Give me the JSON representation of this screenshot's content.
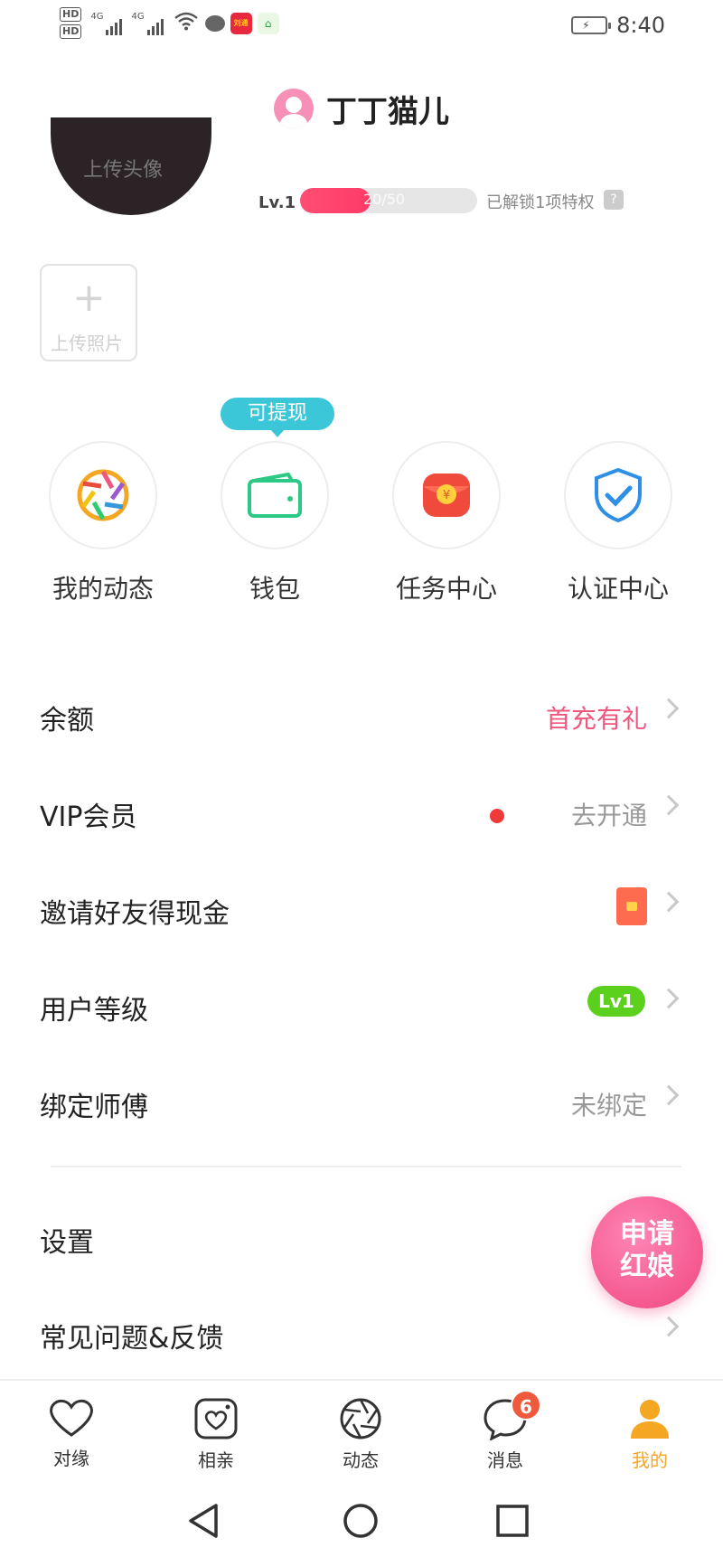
{
  "status_bar": {
    "hd1": "HD",
    "hd2": "HD",
    "sig1": "4G",
    "sig2": "4G",
    "app1": "刘通",
    "time": "8:40"
  },
  "header": {
    "nickname": "丁丁猫儿"
  },
  "profile": {
    "avatar_text": "上传头像",
    "level_label": "Lv.1",
    "progress_text": "20/50",
    "progress_fraction": 0.4,
    "unlock_text": "已解锁1项特权",
    "help_icon": "?",
    "upload_photo_label": "上传照片"
  },
  "quick_actions": {
    "tip": "可提现",
    "items": [
      {
        "label": "我的动态",
        "icon": "aperture-icon"
      },
      {
        "label": "钱包",
        "icon": "wallet-icon"
      },
      {
        "label": "任务中心",
        "icon": "red-packet-icon"
      },
      {
        "label": "认证中心",
        "icon": "shield-check-icon"
      }
    ]
  },
  "menu": [
    {
      "label": "余额",
      "right": "首充有礼"
    },
    {
      "label": "VIP会员",
      "right": "去开通"
    },
    {
      "label": "邀请好友得现金",
      "right": ""
    },
    {
      "label": "用户等级",
      "right": "Lv1"
    },
    {
      "label": "绑定师傅",
      "right": "未绑定"
    },
    {
      "label": "设置",
      "right": ""
    },
    {
      "label": "常见问题&反馈",
      "right": ""
    }
  ],
  "float_button": {
    "line1": "申请",
    "line2": "红娘"
  },
  "tabs": [
    {
      "label": "对缘",
      "icon": "heart-icon"
    },
    {
      "label": "相亲",
      "icon": "camera-heart-icon"
    },
    {
      "label": "动态",
      "icon": "aperture-icon"
    },
    {
      "label": "消息",
      "icon": "chat-bubble-icon",
      "badge": "6"
    },
    {
      "label": "我的",
      "icon": "person-icon",
      "active": true
    }
  ],
  "colors": {
    "accent_pink": "#f0577e",
    "tip_cyan": "#3cc7d8",
    "level_green": "#5bd11d",
    "active_tab": "#f5a623"
  }
}
